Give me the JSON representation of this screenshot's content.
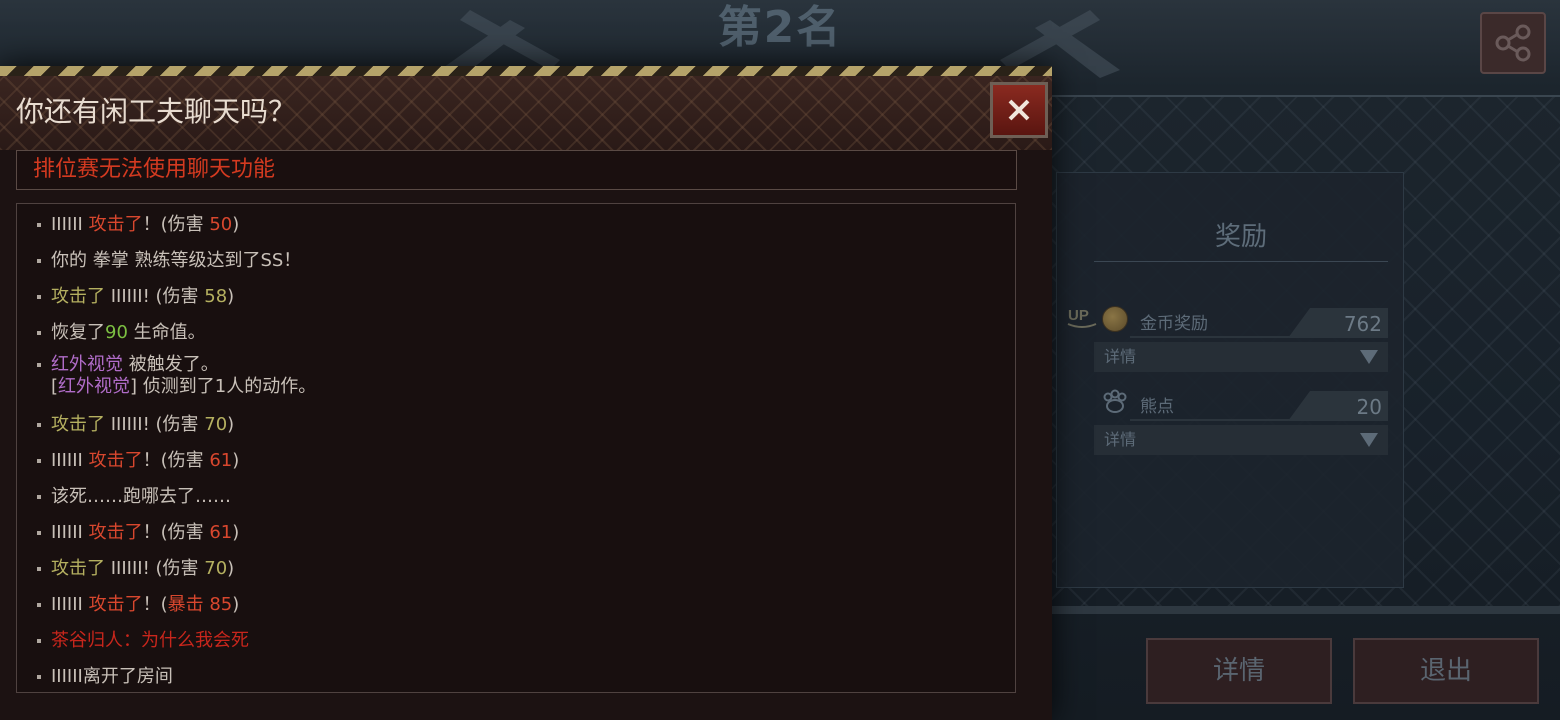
{
  "rank_title": "第2名",
  "reward_panel": {
    "title": "奖励",
    "gold": {
      "label": "金币奖励",
      "value": "762",
      "detail": "详情",
      "badge": "UP"
    },
    "bear": {
      "label": "熊点",
      "value": "20",
      "detail": "详情"
    }
  },
  "buttons": {
    "detail": "详情",
    "exit": "退出"
  },
  "modal": {
    "title": "你还有闲工夫聊天吗？",
    "close": "✕",
    "notice": "排位赛无法使用聊天功能"
  },
  "log": [
    {
      "segments": [
        [
          "IIIIII",
          "white"
        ],
        [
          "  攻击了",
          "red"
        ],
        [
          "！(伤害 ",
          "white"
        ],
        [
          "50",
          "red"
        ],
        [
          ")",
          "white"
        ]
      ]
    },
    {
      "segments": [
        [
          "你的 拳掌 熟练等级达到了SS！",
          "white"
        ]
      ]
    },
    {
      "segments": [
        [
          "攻击了",
          "olive"
        ],
        [
          " IIIIII! (伤害 ",
          "white"
        ],
        [
          "58",
          "olive"
        ],
        [
          ")",
          "white"
        ]
      ]
    },
    {
      "segments": [
        [
          "恢复了",
          "white"
        ],
        [
          "90",
          "green"
        ],
        [
          " 生命值。",
          "white"
        ]
      ]
    },
    {
      "segments": [
        [
          "红外视觉",
          "purple"
        ],
        [
          " 被触发了。",
          "white"
        ]
      ]
    },
    {
      "segments": [
        [
          "[",
          "white"
        ],
        [
          "红外视觉",
          "purple"
        ],
        [
          "] 侦测到了1人的动作。",
          "white"
        ]
      ]
    },
    {
      "segments": [
        [
          "攻击了",
          "olive"
        ],
        [
          " IIIIII! (伤害 ",
          "white"
        ],
        [
          "70",
          "olive"
        ],
        [
          ")",
          "white"
        ]
      ]
    },
    {
      "segments": [
        [
          "IIIIII",
          "white"
        ],
        [
          "  攻击了",
          "red"
        ],
        [
          "！(伤害 ",
          "white"
        ],
        [
          "61",
          "red"
        ],
        [
          ")",
          "white"
        ]
      ]
    },
    {
      "segments": [
        [
          "该死……跑哪去了……",
          "white"
        ]
      ]
    },
    {
      "segments": [
        [
          "IIIIII",
          "white"
        ],
        [
          "  攻击了",
          "red"
        ],
        [
          "！(伤害 ",
          "white"
        ],
        [
          "61",
          "red"
        ],
        [
          ")",
          "white"
        ]
      ]
    },
    {
      "segments": [
        [
          "攻击了",
          "olive"
        ],
        [
          " IIIIII! (伤害 ",
          "white"
        ],
        [
          "70",
          "olive"
        ],
        [
          ")",
          "white"
        ]
      ]
    },
    {
      "segments": [
        [
          "IIIIII",
          "white"
        ],
        [
          "  攻击了",
          "red"
        ],
        [
          "！(",
          "white"
        ],
        [
          "暴击 85",
          "red"
        ],
        [
          ")",
          "white"
        ]
      ]
    },
    {
      "segments": [
        [
          "茶谷归人：为什么我会死",
          "darkred"
        ]
      ]
    },
    {
      "segments": [
        [
          "IIIIII离开了房间",
          "white"
        ]
      ]
    }
  ]
}
